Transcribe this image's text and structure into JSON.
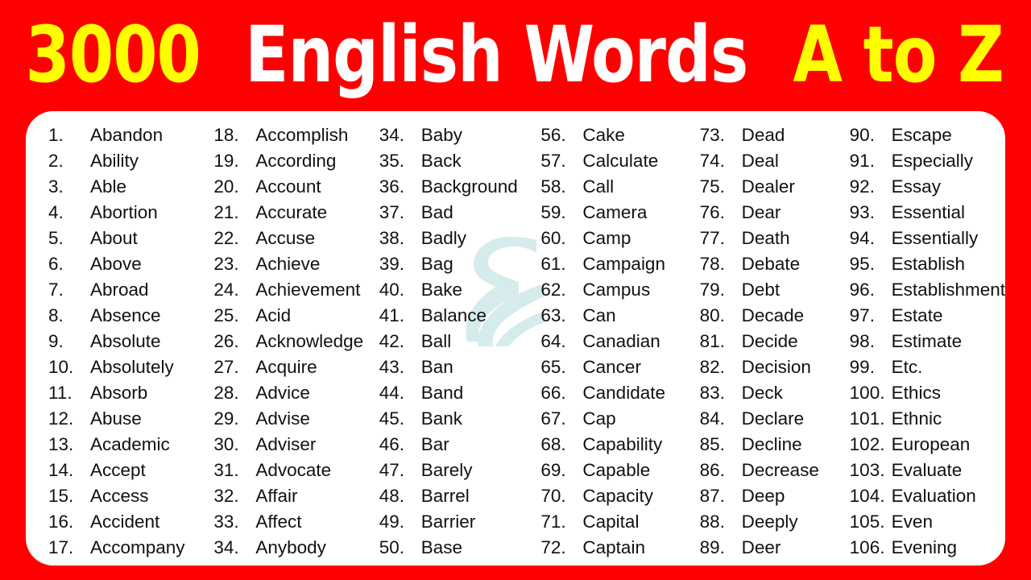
{
  "title": {
    "part1": "3000",
    "part2": "English Words",
    "part3": "A to Z",
    "color_yellow": "#FFFF00",
    "color_white": "#FFFFFF",
    "background": "#FF0000"
  },
  "watermark": {
    "name": "ribbon-swirl-watermark",
    "color": "#CFE8E8"
  },
  "card": {
    "background": "#FFFFFF"
  },
  "columns": [
    {
      "items": [
        {
          "num": "1.",
          "word": "Abandon"
        },
        {
          "num": "2.",
          "word": "Ability"
        },
        {
          "num": "3.",
          "word": "Able"
        },
        {
          "num": "4.",
          "word": "Abortion"
        },
        {
          "num": "5.",
          "word": "About"
        },
        {
          "num": "6.",
          "word": "Above"
        },
        {
          "num": "7.",
          "word": "Abroad"
        },
        {
          "num": "8.",
          "word": "Absence"
        },
        {
          "num": "9.",
          "word": "Absolute"
        },
        {
          "num": "10.",
          "word": "Absolutely"
        },
        {
          "num": "11.",
          "word": "Absorb"
        },
        {
          "num": "12.",
          "word": "Abuse"
        },
        {
          "num": "13.",
          "word": "Academic"
        },
        {
          "num": "14.",
          "word": "Accept"
        },
        {
          "num": "15.",
          "word": "Access"
        },
        {
          "num": "16.",
          "word": "Accident"
        },
        {
          "num": "17.",
          "word": "Accompany"
        }
      ]
    },
    {
      "items": [
        {
          "num": "18.",
          "word": "Accomplish"
        },
        {
          "num": "19.",
          "word": "According"
        },
        {
          "num": "20.",
          "word": "Account"
        },
        {
          "num": "21.",
          "word": "Accurate"
        },
        {
          "num": "22.",
          "word": "Accuse"
        },
        {
          "num": "23.",
          "word": "Achieve"
        },
        {
          "num": "24.",
          "word": "Achievement"
        },
        {
          "num": "25.",
          "word": "Acid"
        },
        {
          "num": "26.",
          "word": "Acknowledge"
        },
        {
          "num": "27.",
          "word": "Acquire"
        },
        {
          "num": "28.",
          "word": "Advice"
        },
        {
          "num": "29.",
          "word": "Advise"
        },
        {
          "num": "30.",
          "word": "Adviser"
        },
        {
          "num": "31.",
          "word": "Advocate"
        },
        {
          "num": "32.",
          "word": "Affair"
        },
        {
          "num": "33.",
          "word": "Affect"
        },
        {
          "num": "34.",
          "word": "Anybody"
        }
      ]
    },
    {
      "items": [
        {
          "num": "34.",
          "word": "Baby"
        },
        {
          "num": "35.",
          "word": "Back"
        },
        {
          "num": "36.",
          "word": "Background"
        },
        {
          "num": "37.",
          "word": "Bad"
        },
        {
          "num": "38.",
          "word": "Badly"
        },
        {
          "num": "39.",
          "word": "Bag"
        },
        {
          "num": "40.",
          "word": "Bake"
        },
        {
          "num": "41.",
          "word": "Balance"
        },
        {
          "num": "42.",
          "word": "Ball"
        },
        {
          "num": "43.",
          "word": "Ban"
        },
        {
          "num": "44.",
          "word": "Band"
        },
        {
          "num": "45.",
          "word": "Bank"
        },
        {
          "num": "46.",
          "word": "Bar"
        },
        {
          "num": "47.",
          "word": "Barely"
        },
        {
          "num": "48.",
          "word": "Barrel"
        },
        {
          "num": "49.",
          "word": "Barrier"
        },
        {
          "num": "50.",
          "word": "Base"
        }
      ]
    },
    {
      "items": [
        {
          "num": "56.",
          "word": "Cake"
        },
        {
          "num": "57.",
          "word": "Calculate"
        },
        {
          "num": "58.",
          "word": "Call"
        },
        {
          "num": "59.",
          "word": "Camera"
        },
        {
          "num": "60.",
          "word": "Camp"
        },
        {
          "num": "61.",
          "word": "Campaign"
        },
        {
          "num": "62.",
          "word": "Campus"
        },
        {
          "num": "63.",
          "word": "Can"
        },
        {
          "num": "64.",
          "word": "Canadian"
        },
        {
          "num": "65.",
          "word": "Cancer"
        },
        {
          "num": "66.",
          "word": "Candidate"
        },
        {
          "num": "67.",
          "word": "Cap"
        },
        {
          "num": "68.",
          "word": "Capability"
        },
        {
          "num": "69.",
          "word": "Capable"
        },
        {
          "num": "70.",
          "word": "Capacity"
        },
        {
          "num": "71.",
          "word": "Capital"
        },
        {
          "num": "72.",
          "word": "Captain"
        }
      ]
    },
    {
      "items": [
        {
          "num": "73.",
          "word": "Dead"
        },
        {
          "num": "74.",
          "word": "Deal"
        },
        {
          "num": "75.",
          "word": "Dealer"
        },
        {
          "num": "76.",
          "word": "Dear"
        },
        {
          "num": "77.",
          "word": "Death"
        },
        {
          "num": "78.",
          "word": "Debate"
        },
        {
          "num": "79.",
          "word": "Debt"
        },
        {
          "num": "80.",
          "word": "Decade"
        },
        {
          "num": "81.",
          "word": "Decide"
        },
        {
          "num": "82.",
          "word": "Decision"
        },
        {
          "num": "83.",
          "word": "Deck"
        },
        {
          "num": "84.",
          "word": "Declare"
        },
        {
          "num": "85.",
          "word": "Decline"
        },
        {
          "num": "86.",
          "word": "Decrease"
        },
        {
          "num": "87.",
          "word": "Deep"
        },
        {
          "num": "88.",
          "word": "Deeply"
        },
        {
          "num": "89.",
          "word": "Deer"
        }
      ]
    },
    {
      "items": [
        {
          "num": "90.",
          "word": "Escape"
        },
        {
          "num": "91.",
          "word": "Especially"
        },
        {
          "num": "92.",
          "word": "Essay"
        },
        {
          "num": "93.",
          "word": "Essential"
        },
        {
          "num": "94.",
          "word": "Essentially"
        },
        {
          "num": "95.",
          "word": "Establish"
        },
        {
          "num": "96.",
          "word": "Establishment"
        },
        {
          "num": "97.",
          "word": "Estate"
        },
        {
          "num": "98.",
          "word": "Estimate"
        },
        {
          "num": "99.",
          "word": "Etc."
        },
        {
          "num": "100.",
          "word": "Ethics"
        },
        {
          "num": "101.",
          "word": "Ethnic"
        },
        {
          "num": "102.",
          "word": "European"
        },
        {
          "num": "103.",
          "word": "Evaluate"
        },
        {
          "num": "104.",
          "word": "Evaluation"
        },
        {
          "num": "105.",
          "word": "Even"
        },
        {
          "num": "106.",
          "word": "Evening"
        }
      ]
    }
  ]
}
